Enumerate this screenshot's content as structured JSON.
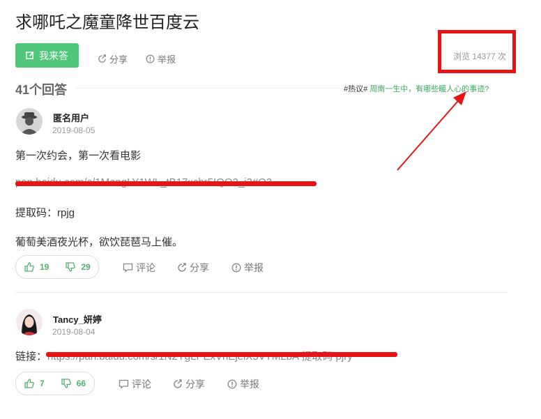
{
  "page": {
    "title": "求哪吒之魔童降世百度云",
    "answer_button": "我来答",
    "share": "分享",
    "report": "举报",
    "views": "浏览 14377 次"
  },
  "answers_header": {
    "count_label": "41个回答",
    "hot_tag": "#热议#",
    "hot_link": "周南一生中，有哪些暖人心的事迹?"
  },
  "answers": [
    {
      "user": "匿名用户",
      "date": "2019-08-05",
      "line1": "第一次约会，第一次看电影",
      "link": "pan.baidu.com/s/1MangLY1WL_tB17xcbr5IQO2_i3#O3",
      "line3": "提取码：rpjg",
      "line4": "葡萄美酒夜光杯，欲饮琵琶马上催。",
      "upvotes": "19",
      "downvotes": "29",
      "comment": "评论",
      "share": "分享",
      "report": "举报"
    },
    {
      "user": "Tancy_妍婷",
      "date": "2019-08-04",
      "link_label": "链接：",
      "link": "https://pan.baidu.com/s/1N2YgLPExVnEjeiX5VTMLbA 提取码 pjry",
      "upvotes": "7",
      "downvotes": "66",
      "comment": "评论",
      "share": "分享",
      "report": "举报"
    }
  ],
  "colors": {
    "accent_green": "#50c67a",
    "annotation_red": "#e51515"
  }
}
